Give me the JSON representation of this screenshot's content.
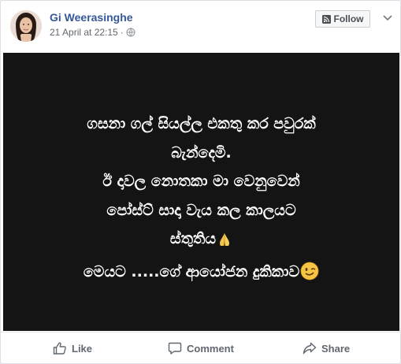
{
  "post": {
    "author": "Gi Weerasinghe",
    "timestamp": "21 April at 22:15",
    "separator": "·",
    "follow_label": "Follow",
    "icons": [
      "avatar-photo",
      "globe-icon",
      "rss-icon",
      "chevron-down-icon"
    ],
    "text_lines": [
      "ගසනා ගල් සියල්ල එකතු කර පවුරක්",
      "බැන්දෙමි.",
      "ඊ දාවල නොතකා මා වෙනුවෙන්",
      "පෝස්ට් සාදා වැය කල කාලයට",
      "ස්තුතිය"
    ],
    "last_line_prefix": "මෙයට",
    "last_line_dots": ".....",
    "last_line_suffix": "ගේ ආයෝජන දුකිකාව",
    "emojis": [
      "praying-hands-icon",
      "winking-face-icon"
    ],
    "image_bg": "#141414"
  },
  "actions": {
    "like_label": "Like",
    "comment_label": "Comment",
    "share_label": "Share"
  },
  "colors": {
    "link": "#365899",
    "meta": "#616770",
    "action": "#606770",
    "card_border": "#dddfe2"
  }
}
